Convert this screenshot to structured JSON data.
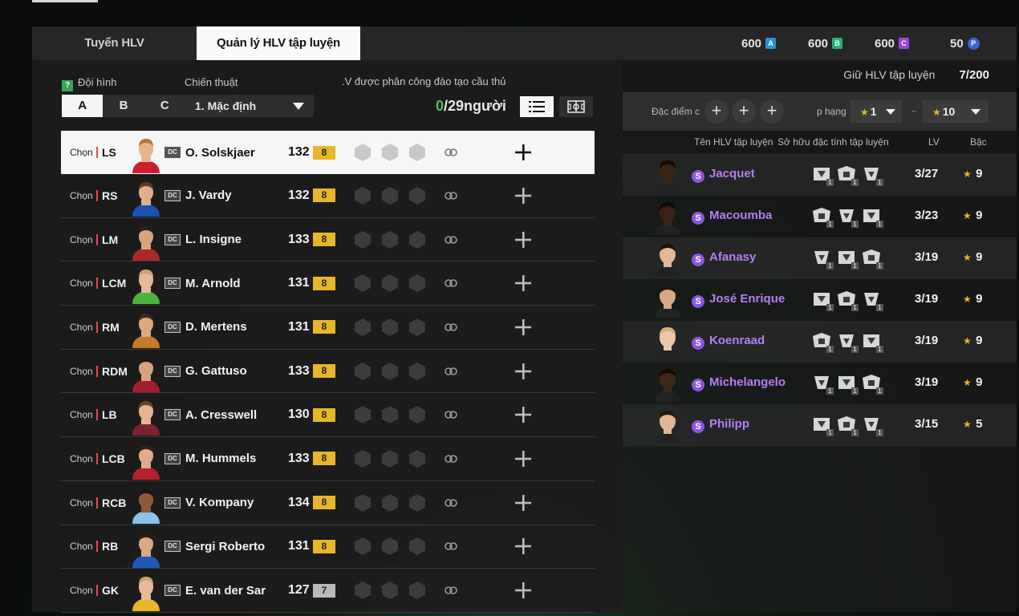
{
  "tabs": [
    {
      "label": "Tuyển HLV",
      "active": false
    },
    {
      "label": "Quản lý HLV tập luyện",
      "active": true
    }
  ],
  "currencies": [
    {
      "amount": "600",
      "icon": "A"
    },
    {
      "amount": "600",
      "icon": "B"
    },
    {
      "amount": "600",
      "icon": "C"
    },
    {
      "amount": "50",
      "icon": "P"
    }
  ],
  "left_panel": {
    "formation_label": "Đội hình",
    "tactic_label": "Chiến thuật",
    "assigned_label": ".V được phân công đào tạo cầu thủ",
    "squads": [
      "A",
      "B",
      "C"
    ],
    "active_squad": "A",
    "tactic_value": "1. Mặc định",
    "count_current": "0",
    "count_rest": "/29người",
    "select_label": "Chọn",
    "players": [
      {
        "pos": "LS",
        "name": "O. Solskjaer",
        "ovr": "132",
        "lvl": "8",
        "selected": true,
        "kit": "#c8202c",
        "skin": "#e3b58e",
        "hair": "#b07a3a"
      },
      {
        "pos": "RS",
        "name": "J. Vardy",
        "ovr": "132",
        "lvl": "8",
        "selected": false,
        "kit": "#1d4fb0",
        "skin": "#e1af8a",
        "hair": "#5a3a22"
      },
      {
        "pos": "LM",
        "name": "L. Insigne",
        "ovr": "133",
        "lvl": "8",
        "selected": false,
        "kit": "#a82a2a",
        "skin": "#d9a57d",
        "hair": "#2b1f17"
      },
      {
        "pos": "LCM",
        "name": "M. Arnold",
        "ovr": "131",
        "lvl": "8",
        "selected": false,
        "kit": "#4db33d",
        "skin": "#e6b896",
        "hair": "#c9a27a"
      },
      {
        "pos": "RM",
        "name": "D. Mertens",
        "ovr": "131",
        "lvl": "8",
        "selected": false,
        "kit": "#c8782a",
        "skin": "#dba983",
        "hair": "#3a2a1e"
      },
      {
        "pos": "RDM",
        "name": "G. Gattuso",
        "ovr": "133",
        "lvl": "8",
        "selected": false,
        "kit": "#9e1f2b",
        "skin": "#d6a37c",
        "hair": "#1f1712"
      },
      {
        "pos": "LB",
        "name": "A. Cresswell",
        "ovr": "130",
        "lvl": "8",
        "selected": false,
        "kit": "#7a2333",
        "skin": "#e4b491",
        "hair": "#5e432b"
      },
      {
        "pos": "LCB",
        "name": "M. Hummels",
        "ovr": "133",
        "lvl": "8",
        "selected": false,
        "kit": "#b5202e",
        "skin": "#e0ad88",
        "hair": "#2f231a"
      },
      {
        "pos": "RCB",
        "name": "V. Kompany",
        "ovr": "134",
        "lvl": "8",
        "selected": false,
        "kit": "#8cc4e8",
        "skin": "#8a5a3c",
        "hair": "#1b140f"
      },
      {
        "pos": "RB",
        "name": "Sergi Roberto",
        "ovr": "131",
        "lvl": "8",
        "selected": false,
        "kit": "#2255b8",
        "skin": "#dba983",
        "hair": "#2a1d14"
      },
      {
        "pos": "GK",
        "name": "E. van der Sar",
        "ovr": "127",
        "lvl": "7",
        "selected": false,
        "kit": "#e7b62a",
        "skin": "#e8bb98",
        "hair": "#caa474"
      }
    ]
  },
  "right_panel": {
    "keep_label": "Giữ HLV tập luyện",
    "keep_value": "7/200",
    "filter_label": "Đặc điểm c",
    "rank_label": "p hạng",
    "rank_from": "1",
    "rank_sep": "~",
    "rank_to": "10",
    "headers": {
      "name": "Tên HLV tập luyện",
      "traits": "Sở hữu đặc tính tập luyện",
      "lv": "LV",
      "grade": "Bậc"
    },
    "coaches": [
      {
        "name": "Jacquet",
        "lv": "3/27",
        "grade": "9",
        "skin": "#3b2416",
        "hair": "#120c08"
      },
      {
        "name": "Macoumba",
        "lv": "3/23",
        "grade": "9",
        "skin": "#3a2217",
        "hair": "#110b07"
      },
      {
        "name": "Afanasy",
        "lv": "3/19",
        "grade": "9",
        "skin": "#e3b896",
        "hair": "#1c1410"
      },
      {
        "name": "José Enrique",
        "lv": "3/19",
        "grade": "9",
        "skin": "#d8a784",
        "hair": "#1d150f"
      },
      {
        "name": "Koenraad",
        "lv": "3/19",
        "grade": "9",
        "skin": "#ecc6a7",
        "hair": "#d2b07d"
      },
      {
        "name": "Michelangelo",
        "lv": "3/19",
        "grade": "9",
        "skin": "#3e2619",
        "hair": "#130d09"
      },
      {
        "name": "Philipp",
        "lv": "3/15",
        "grade": "5",
        "skin": "#e2b592",
        "hair": "#20170f"
      }
    ],
    "trait_sub": "1"
  },
  "colors": {
    "accent_green": "#4ec06b",
    "coach_name": "#b67ef3",
    "level_gold": "#e7b62a"
  }
}
